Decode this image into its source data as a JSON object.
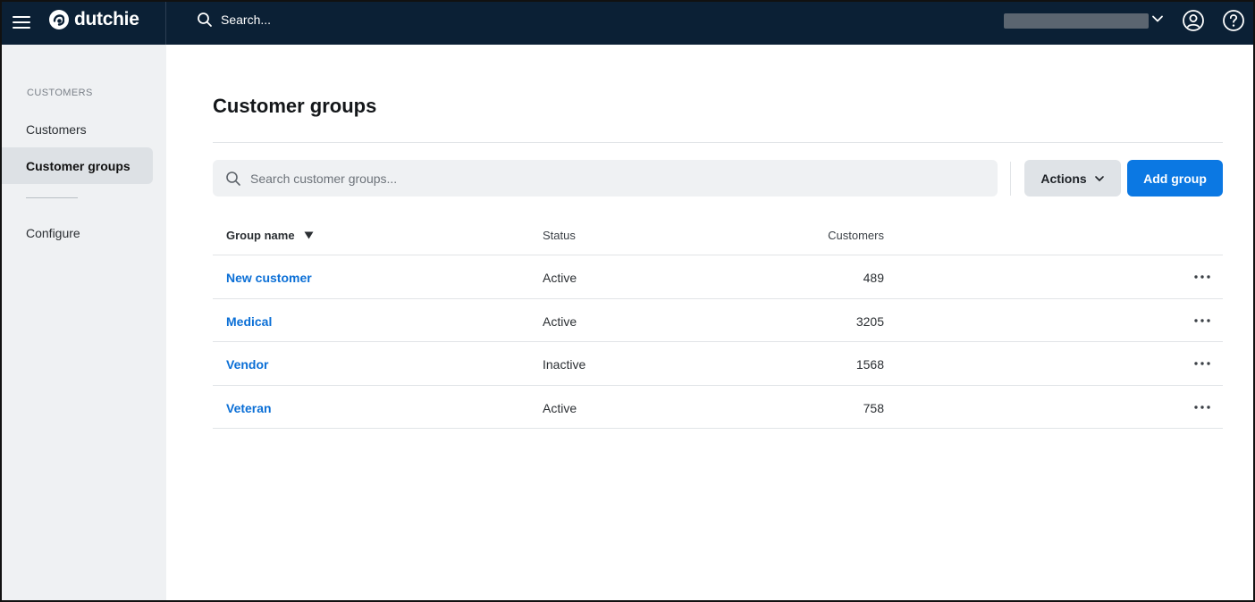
{
  "app": {
    "logo_text": "dutchie",
    "top_search_placeholder": "Search...",
    "colors": {
      "topbar": "#0b2035",
      "accent": "#0b78e3",
      "link": "#0b6fd6",
      "sidebar": "#eff1f3"
    }
  },
  "sidebar": {
    "section_label": "CUSTOMERS",
    "items": [
      {
        "label": "Customers",
        "active": false
      },
      {
        "label": "Customer groups",
        "active": true
      }
    ],
    "configure_label": "Configure"
  },
  "main": {
    "title": "Customer groups",
    "search_placeholder": "Search customer groups...",
    "actions_label": "Actions",
    "add_label": "Add group"
  },
  "table": {
    "columns": {
      "name": "Group name",
      "status": "Status",
      "customers": "Customers"
    },
    "rows": [
      {
        "name": "New customer",
        "status": "Active",
        "customers": "489"
      },
      {
        "name": "Medical",
        "status": "Active",
        "customers": "3205"
      },
      {
        "name": "Vendor",
        "status": "Inactive",
        "customers": "1568"
      },
      {
        "name": "Veteran",
        "status": "Active",
        "customers": "758"
      }
    ]
  }
}
